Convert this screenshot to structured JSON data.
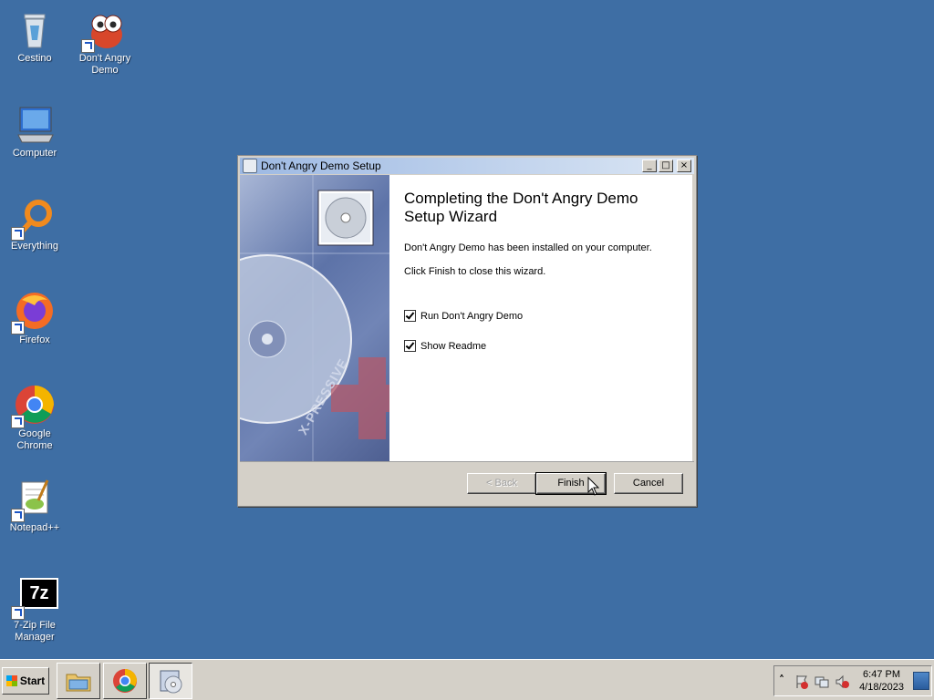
{
  "desktop": {
    "icons": [
      {
        "label": "Cestino"
      },
      {
        "label": "Don't Angry Demo"
      },
      {
        "label": "Computer"
      },
      {
        "label": "Everything"
      },
      {
        "label": "Firefox"
      },
      {
        "label": "Google Chrome"
      },
      {
        "label": "Notepad++"
      },
      {
        "label": "7-Zip File Manager"
      }
    ],
    "icon_7zip_text": "7z"
  },
  "window": {
    "title": "Don't Angry Demo  Setup",
    "heading": "Completing the Don't Angry Demo Setup Wizard",
    "installed_text": "Don't Angry Demo  has been installed on your computer.",
    "close_text": "Click Finish to close this wizard.",
    "checkbox_run": {
      "label": "Run Don't Angry Demo",
      "checked": true
    },
    "checkbox_readme": {
      "label": "Show Readme",
      "checked": true
    },
    "buttons": {
      "back": "< Back",
      "finish": "Finish",
      "cancel": "Cancel"
    },
    "banner_text": "X-PRESSIVE",
    "controls": {
      "minimize": "_",
      "maximize": "□",
      "close": "×"
    }
  },
  "taskbar": {
    "start_label": "Start",
    "apps": [
      "file-explorer-icon",
      "chrome-icon",
      "setup-icon"
    ],
    "tray": {
      "time": "6:47 PM",
      "date": "4/18/2023",
      "expand": "˄"
    }
  },
  "colors": {
    "desktop": "#3e6ea4",
    "titlebar": "#9db9e3",
    "face": "#d4d0c8"
  }
}
